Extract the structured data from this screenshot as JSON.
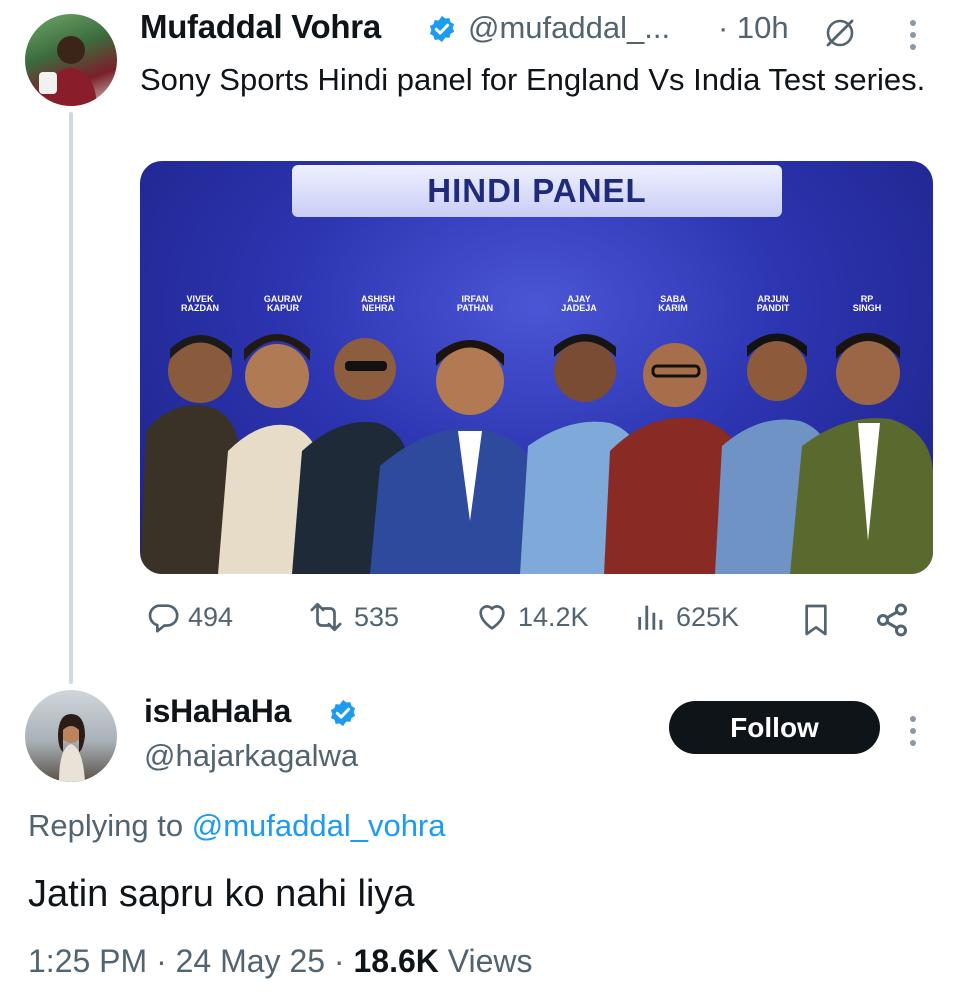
{
  "tweet": {
    "author_name": "Mufaddal Vohra",
    "author_handle": "@mufaddal_...",
    "time": "· 10h",
    "text": "Sony Sports Hindi panel for England Vs India Test series.",
    "media": {
      "banner_text": "HINDI PANEL",
      "panelists": [
        {
          "first": "VIVEK",
          "last": "RAZDAN"
        },
        {
          "first": "GAURAV",
          "last": "KAPUR"
        },
        {
          "first": "ASHISH",
          "last": "NEHRA"
        },
        {
          "first": "IRFAN",
          "last": "PATHAN"
        },
        {
          "first": "AJAY",
          "last": "JADEJA"
        },
        {
          "first": "SABA",
          "last": "KARIM"
        },
        {
          "first": "ARJUN",
          "last": "PANDIT"
        },
        {
          "first": "RP",
          "last": "SINGH"
        }
      ]
    },
    "stats": {
      "replies": "494",
      "reposts": "535",
      "likes": "14.2K",
      "views": "625K"
    }
  },
  "reply": {
    "author_name": "isHaHaHa",
    "author_handle": "@hajarkagalwa",
    "follow_label": "Follow",
    "replying_prefix": "Replying to",
    "replying_handle": "@mufaddal_vohra",
    "text": "Jatin sapru ko nahi liya",
    "time": "1:25 PM · 24 May 25 ·",
    "views_count": "18.6K",
    "views_label": "Views"
  },
  "colors": {
    "accent": "#1d9bf0",
    "muted": "#536471",
    "follow_bg": "#0f1419"
  }
}
